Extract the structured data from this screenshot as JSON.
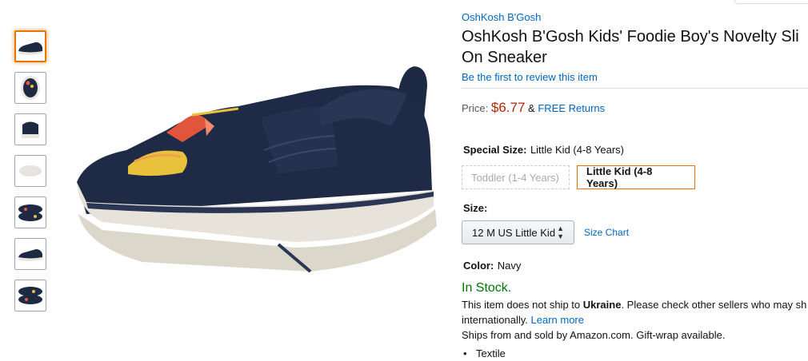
{
  "thumbnails": [
    {
      "name": "shoe-side",
      "selected": true
    },
    {
      "name": "shoe-top"
    },
    {
      "name": "shoe-back"
    },
    {
      "name": "shoe-sole"
    },
    {
      "name": "shoe-pair-top"
    },
    {
      "name": "shoe-side-2"
    },
    {
      "name": "shoe-pair-top-2"
    }
  ],
  "product": {
    "brand": "OshKosh B'Gosh",
    "title_line1": "OshKosh B'Gosh Kids' Foodie Boy's Novelty Sli",
    "title_line2": "On Sneaker",
    "review_link": "Be the first to review this item",
    "price_label": "Price:",
    "price": "$6.77",
    "price_amp": "&",
    "free_returns": "FREE Returns",
    "special_size_label": "Special Size:",
    "special_size_value": "Little Kid (4-8 Years)",
    "size_options": [
      "Toddler (1-4 Years)",
      "Little Kid (4-8 Years)"
    ],
    "size_label": "Size:",
    "size_selected": "12 M US Little Kid",
    "size_chart": "Size Chart",
    "color_label": "Color:",
    "color_value": "Navy",
    "stock": "In Stock.",
    "ship_line1_pre": "This item does not ship to ",
    "ship_country": "Ukraine",
    "ship_line1_post": ". Please check other sellers who may sh",
    "ship_line2": "internationally.",
    "learn_more": "Learn more",
    "ships_from": "Ships from and sold by Amazon.com. Gift-wrap available.",
    "bullets": [
      "Textile"
    ]
  },
  "colors": {
    "link": "#0066c0",
    "price": "#b12704",
    "stock": "#007600",
    "selected_border": "#e77600",
    "navy": "#1e2a44"
  }
}
